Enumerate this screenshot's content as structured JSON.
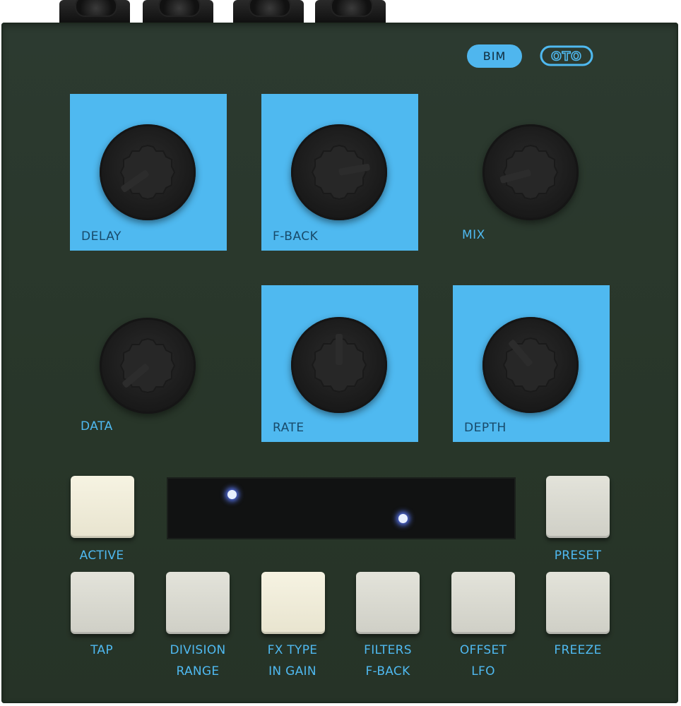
{
  "brand": {
    "pill_label": "BIM",
    "logo_text": "OTO"
  },
  "knobs": [
    {
      "key": "delay",
      "label": "DELAY",
      "highlighted": true
    },
    {
      "key": "fback",
      "label": "F-BACK",
      "highlighted": true
    },
    {
      "key": "mix",
      "label": "MIX",
      "highlighted": false
    },
    {
      "key": "data",
      "label": "DATA",
      "highlighted": false
    },
    {
      "key": "rate",
      "label": "RATE",
      "highlighted": true
    },
    {
      "key": "depth",
      "label": "DEPTH",
      "highlighted": true
    }
  ],
  "buttons": {
    "active": {
      "label": "ACTIVE"
    },
    "preset": {
      "label": "PRESET"
    },
    "tap": {
      "label": "TAP"
    },
    "division": {
      "label": "DIVISION",
      "sublabel": "RANGE"
    },
    "fx_type": {
      "label": "FX TYPE",
      "sublabel": "IN GAIN"
    },
    "filters": {
      "label": "FILTERS",
      "sublabel": "F-BACK"
    },
    "offset": {
      "label": "OFFSET",
      "sublabel": "LFO"
    },
    "freeze": {
      "label": "FREEZE"
    }
  },
  "colors": {
    "panel": "#2a382b",
    "accent_blue": "#4fb9f0",
    "button_face": "#d9d9d0",
    "display_led": "#5c7cff"
  }
}
